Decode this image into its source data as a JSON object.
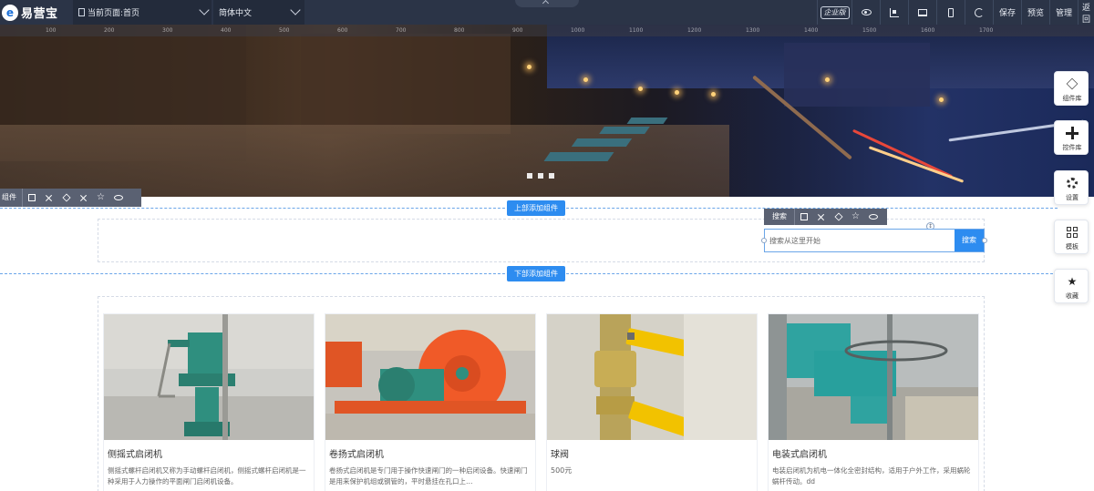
{
  "topbar": {
    "logo_text": "易营宝",
    "logo_mark": "e",
    "current_page_label": "当前页面:首页",
    "language_label": "简体中文",
    "enterprise_badge": "企业版",
    "save_label": "保存",
    "preview_label": "预览",
    "manage_label": "管理",
    "back_label": "返回",
    "icons": [
      "eye-icon",
      "layout-icon",
      "desktop-icon",
      "phone-icon",
      "refresh-icon"
    ]
  },
  "ruler": [
    "100",
    "200",
    "300",
    "400",
    "500",
    "600",
    "700",
    "800",
    "900",
    "1000",
    "1100",
    "1200",
    "1300",
    "1400",
    "1500",
    "1600",
    "1700"
  ],
  "banner": {
    "slide_count": 3,
    "accent_light": "#ffd27a"
  },
  "component_toolbar": {
    "label": "组件"
  },
  "add_top_label": "上部添加组件",
  "add_bottom_label": "下部添加组件",
  "search": {
    "toolbar_label": "搜索",
    "placeholder": "搜索从这里开始",
    "button_label": "搜索"
  },
  "sidepanel": {
    "items": [
      {
        "label": "组件库",
        "icon": "component-library-icon"
      },
      {
        "label": "控件库",
        "icon": "plus-icon"
      },
      {
        "label": "设置",
        "icon": "settings-gear-icon"
      },
      {
        "label": "模板",
        "icon": "template-grid-icon"
      },
      {
        "label": "收藏",
        "icon": "favorite-star-icon"
      }
    ]
  },
  "products": [
    {
      "name": "侧摇式启闭机",
      "desc": "侧摇式螺杆启闭机又称为手动螺杆启闭机，侧摇式螺杆启闭机是一种采用于人力操作的平面闸门启闭机设备。",
      "price": ""
    },
    {
      "name": "卷扬式启闭机",
      "desc": "卷扬式启闭机是专门用于操作快速闸门的一种启闭设备。快速闸门是用来保护机组或钢管的，平时悬挂在孔口上…",
      "price": ""
    },
    {
      "name": "球阀",
      "desc": "",
      "price": "500元"
    },
    {
      "name": "电装式启闭机",
      "desc": "电装启闭机为机电一体化全密封结构，适用于户外工作，采用蜗轮蜗杆传动。dd",
      "price": ""
    }
  ],
  "colors": {
    "toolbar_bg": "#2b3447",
    "accent_blue": "#2d8cf0",
    "valve_yellow": "#f2c200",
    "machine_teal": "#2f8f7f",
    "machine_orange": "#f05a28"
  }
}
